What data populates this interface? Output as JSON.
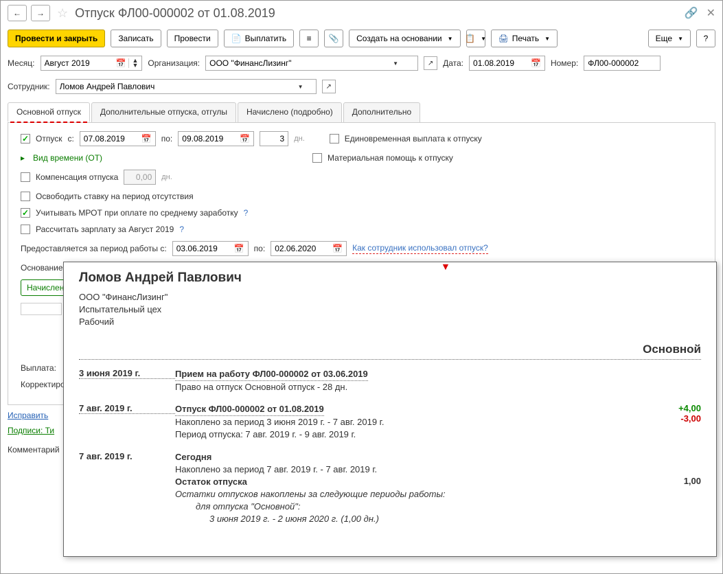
{
  "title": "Отпуск ФЛ00-000002 от 01.08.2019",
  "toolbar": {
    "submit_close": "Провести и закрыть",
    "save": "Записать",
    "submit": "Провести",
    "pay": "Выплатить",
    "create_based": "Создать на основании",
    "print": "Печать",
    "more": "Еще",
    "help": "?"
  },
  "fields": {
    "month_label": "Месяц:",
    "month_value": "Август 2019",
    "org_label": "Организация:",
    "org_value": "ООО \"ФинансЛизинг\"",
    "date_label": "Дата:",
    "date_value": "01.08.2019",
    "number_label": "Номер:",
    "number_value": "ФЛ00-000002",
    "employee_label": "Сотрудник:",
    "employee_value": "Ломов Андрей Павлович"
  },
  "tabs": {
    "main": "Основной отпуск",
    "additional": "Дополнительные отпуска, отгулы",
    "accrued": "Начислено (подробно)",
    "extra": "Дополнительно"
  },
  "main_tab": {
    "vacation_label": "Отпуск",
    "from_label": "с:",
    "from_date": "07.08.2019",
    "to_label": "по:",
    "to_date": "09.08.2019",
    "days": "3",
    "days_label": "дн.",
    "lump_sum": "Единовременная выплата к отпуску",
    "material_help": "Материальная помощь к отпуску",
    "time_type": "Вид времени (ОТ)",
    "compensation_label": "Компенсация отпуска",
    "compensation_value": "0,00",
    "compensation_unit": "дн.",
    "free_rate": "Освободить ставку на период отсутствия",
    "mrot": "Учитывать МРОТ при оплате по среднему заработку",
    "calc_salary": "Рассчитать зарплату за Август 2019",
    "period_label": "Предоставляется за период работы с:",
    "period_from": "03.06.2019",
    "period_to_label": "по:",
    "period_to": "02.06.2020",
    "how_used": "Как сотрудник использовал отпуск?",
    "basis_label": "Основание",
    "accrued_label": "Начислен",
    "payout_label": "Выплата:",
    "corrected_label": "Корректиро"
  },
  "bottom": {
    "fix": "Исправить",
    "signatures": "Подписи: Ти",
    "comment_label": "Комментарий"
  },
  "popup": {
    "name": "Ломов Андрей Павлович",
    "org": "ООО \"ФинансЛизинг\"",
    "dept": "Испытательный цех",
    "position": "Рабочий",
    "section": "Основной",
    "rows": [
      {
        "date": "3 июня 2019 г.",
        "title": "Прием на работу ФЛ00-000002 от 03.06.2019",
        "line1": "Право на отпуск Основной отпуск - 28 дн."
      },
      {
        "date": "7 авг. 2019 г.",
        "title": "Отпуск ФЛ00-000002 от 01.08.2019",
        "line1": "Накоплено за период 3 июня 2019 г. - 7 авг. 2019 г.",
        "line2": "Период отпуска: 7 авг. 2019 г. - 9 авг. 2019 г.",
        "val1": "+4,00",
        "val2": "-3,00"
      },
      {
        "date": "7 авг. 2019 г.",
        "title_plain": "Сегодня",
        "line1": "Накоплено за период 7 авг. 2019 г. - 7 авг. 2019 г.",
        "bold2": "Остаток отпуска",
        "italic1": "Остатки отпусков накоплены за следующие периоды работы:",
        "italic2": "для отпуска \"Основной\":",
        "italic3": "3 июня 2019 г. - 2 июня 2020 г. (1,00 дн.)",
        "val1": "1,00"
      }
    ]
  }
}
